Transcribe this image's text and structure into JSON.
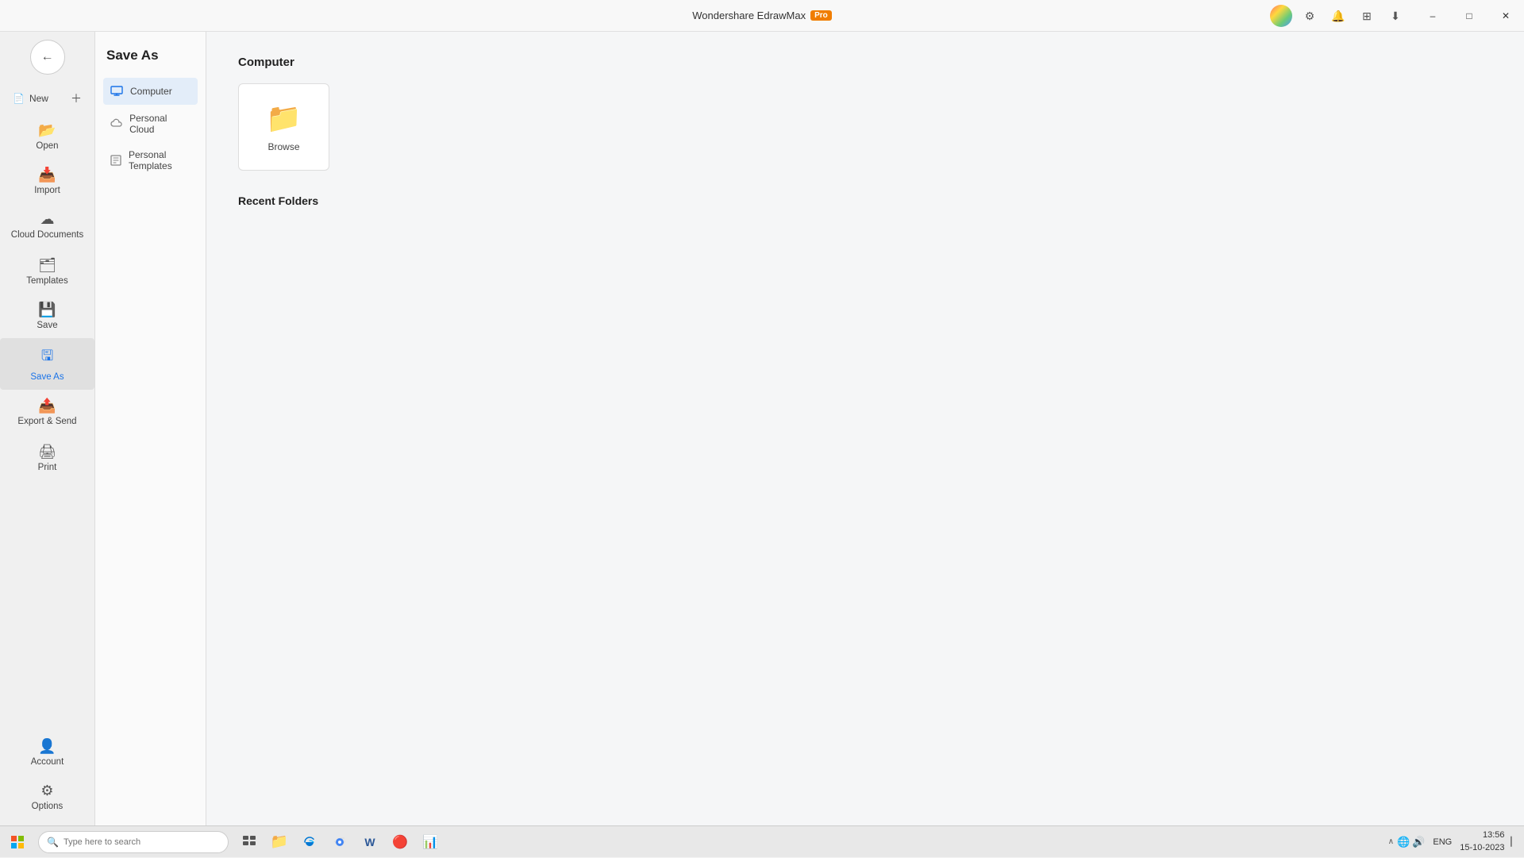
{
  "titlebar": {
    "app_name": "Wondershare EdrawMax",
    "pro_badge": "Pro"
  },
  "sidebar": {
    "items": [
      {
        "id": "new",
        "label": "New",
        "icon": "📄"
      },
      {
        "id": "open",
        "label": "Open",
        "icon": "📂"
      },
      {
        "id": "import",
        "label": "Import",
        "icon": "📥"
      },
      {
        "id": "cloud-documents",
        "label": "Cloud Documents",
        "icon": "☁"
      },
      {
        "id": "templates",
        "label": "Templates",
        "icon": "🗂"
      },
      {
        "id": "save",
        "label": "Save",
        "icon": "💾"
      },
      {
        "id": "save-as",
        "label": "Save As",
        "icon": "🖫",
        "active": true
      },
      {
        "id": "export-send",
        "label": "Export & Send",
        "icon": "📤"
      },
      {
        "id": "print",
        "label": "Print",
        "icon": "🖨"
      }
    ],
    "bottom_items": [
      {
        "id": "account",
        "label": "Account",
        "icon": "👤"
      },
      {
        "id": "options",
        "label": "Options",
        "icon": "⚙"
      }
    ]
  },
  "panel": {
    "title": "Save As",
    "sub_items": [
      {
        "id": "computer",
        "label": "Computer",
        "active": true
      },
      {
        "id": "personal-cloud",
        "label": "Personal Cloud"
      },
      {
        "id": "personal-templates",
        "label": "Personal Templates"
      }
    ]
  },
  "main": {
    "section_title": "Computer",
    "browse_label": "Browse",
    "recent_folders_title": "Recent Folders"
  },
  "taskbar": {
    "search_placeholder": "Type here to search",
    "time": "13:56",
    "date": "15-10-2023",
    "lang": "ENG"
  }
}
